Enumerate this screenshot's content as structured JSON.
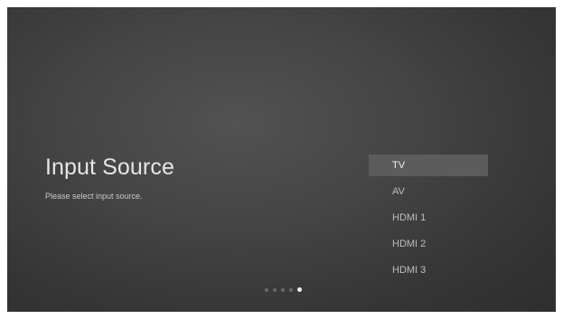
{
  "setup": {
    "title": "Input Source",
    "subtitle": "Please select input source."
  },
  "sources": [
    {
      "label": "TV",
      "selected": true
    },
    {
      "label": "AV",
      "selected": false
    },
    {
      "label": "HDMI 1",
      "selected": false
    },
    {
      "label": "HDMI 2",
      "selected": false
    },
    {
      "label": "HDMI 3",
      "selected": false
    }
  ],
  "pagination": {
    "total_steps": 5,
    "current_step": 5
  },
  "colors": {
    "background": "#444444",
    "selected_highlight": "#5c5c5c",
    "text_primary": "#e6e6e6",
    "text_secondary": "#bdbdbd",
    "active_dot": "#f2f2f2",
    "inactive_dot": "#6a6a6a"
  }
}
